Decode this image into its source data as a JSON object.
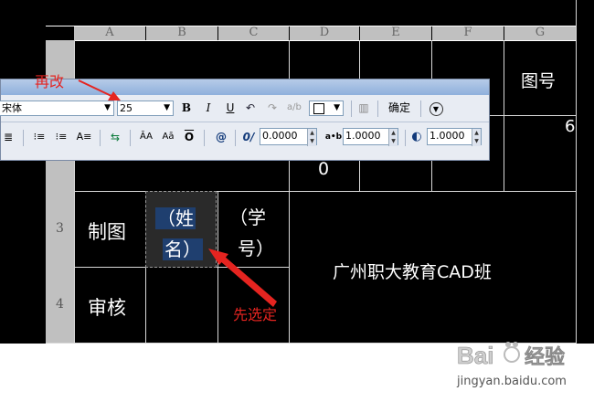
{
  "columns": [
    "A",
    "B",
    "C",
    "D",
    "E",
    "F",
    "G"
  ],
  "rows": [
    "3",
    "4"
  ],
  "cells": {
    "g_header": "图号",
    "right_value": "6",
    "partial_zero": "0",
    "a3": "制图",
    "b3_line1": "（姓",
    "b3_line2": "名）",
    "c3_line1": "（学",
    "c3_line2": "号）",
    "a4": "审核",
    "school": "广州职大教育CAD班"
  },
  "toolbar": {
    "font_name": "宋体",
    "height_value": "25",
    "bold": "B",
    "italic": "I",
    "underline": "U",
    "ok_label": "确定",
    "oblique_value": "0.0000",
    "tracking_value": "1.0000",
    "width_value": "1.0000",
    "upper_label": "ĀA",
    "lower_label": "Aā",
    "at_label": "@",
    "oblique_icon_label": "0/",
    "tracking_icon_label": "a•b"
  },
  "annotations": {
    "change_again": "再改",
    "select_first": "先选定"
  },
  "watermark": {
    "brand": "Bai 经验",
    "url": "jingyan.baidu.com"
  },
  "colors": {
    "annotation": "#e52420",
    "selection": "#1f3f6f",
    "toolbar_bg": "#e8ecf3"
  }
}
